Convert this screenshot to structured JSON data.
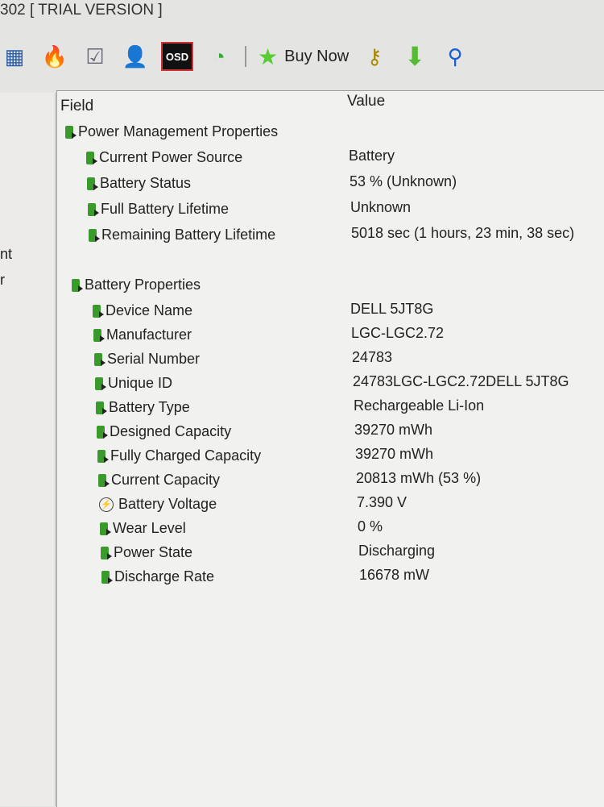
{
  "window": {
    "title": "302  [ TRIAL VERSION ]"
  },
  "toolbar": {
    "buy_label": "Buy Now",
    "icons": [
      "motherboard-icon",
      "flame-icon",
      "report-icon",
      "user-icon",
      "osd-icon",
      "gauge-icon",
      "buy-star-icon",
      "key-icon",
      "download-icon",
      "search-icon"
    ],
    "osd_label": "OSD"
  },
  "sidebar": {
    "items": [
      "nt",
      "r"
    ]
  },
  "columns": {
    "field": "Field",
    "value": "Value"
  },
  "groups": [
    {
      "label": "Power Management Properties",
      "rows": [
        {
          "field": "Current Power Source",
          "value": "Battery"
        },
        {
          "field": "Battery Status",
          "value": "53 % (Unknown)"
        },
        {
          "field": "Full Battery Lifetime",
          "value": "Unknown"
        },
        {
          "field": "Remaining Battery Lifetime",
          "value": "5018 sec (1 hours, 23 min, 38 sec)"
        }
      ]
    },
    {
      "label": "Battery Properties",
      "rows": [
        {
          "field": "Device Name",
          "value": "DELL 5JT8G"
        },
        {
          "field": "Manufacturer",
          "value": "LGC-LGC2.72"
        },
        {
          "field": "Serial Number",
          "value": "24783"
        },
        {
          "field": "Unique ID",
          "value": "24783LGC-LGC2.72DELL 5JT8G"
        },
        {
          "field": "Battery Type",
          "value": "Rechargeable Li-Ion"
        },
        {
          "field": "Designed Capacity",
          "value": "39270 mWh"
        },
        {
          "field": "Fully Charged Capacity",
          "value": "39270 mWh"
        },
        {
          "field": "Current Capacity",
          "value": "20813 mWh  (53 %)"
        },
        {
          "field": "Battery Voltage",
          "value": "7.390 V"
        },
        {
          "field": "Wear Level",
          "value": "0 %"
        },
        {
          "field": "Power State",
          "value": "Discharging"
        },
        {
          "field": "Discharge Rate",
          "value": "16678 mW"
        }
      ]
    }
  ]
}
